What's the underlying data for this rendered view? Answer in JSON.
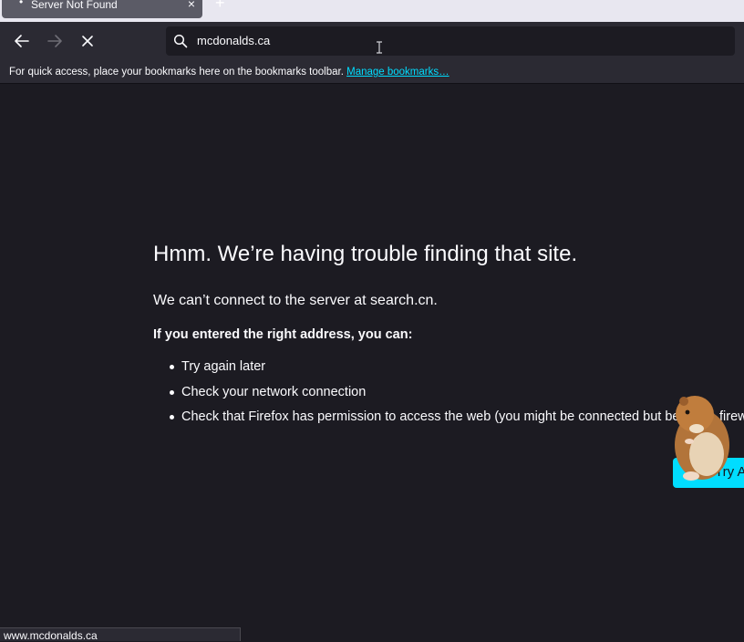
{
  "tab": {
    "title": "Server Not Found",
    "close_glyph": "×",
    "new_tab_glyph": "+"
  },
  "navbar": {
    "back_icon": "arrow-left-icon",
    "forward_icon": "arrow-right-icon",
    "stop_icon": "close-icon",
    "url_value": "mcdonalds.ca"
  },
  "bookmarks": {
    "message": "For quick access, place your bookmarks here on the bookmarks toolbar.",
    "manage_link": "Manage bookmarks…"
  },
  "error": {
    "title": "Hmm. We’re having trouble finding that site.",
    "subtitle": "We can’t connect to the server at search.cn.",
    "lead": "If you entered the right address, you can:",
    "items": [
      "Try again later",
      "Check your network connection",
      "Check that Firefox has permission to access the web (you might be connected but behind a firewall)"
    ],
    "try_again_label": "Try Again"
  },
  "status": {
    "url": "www.mcdonalds.ca"
  },
  "colors": {
    "page_bg": "#1c1b22",
    "toolbar_bg": "#2b2a33",
    "accent": "#00ddff",
    "text": "#fbfbfe"
  }
}
